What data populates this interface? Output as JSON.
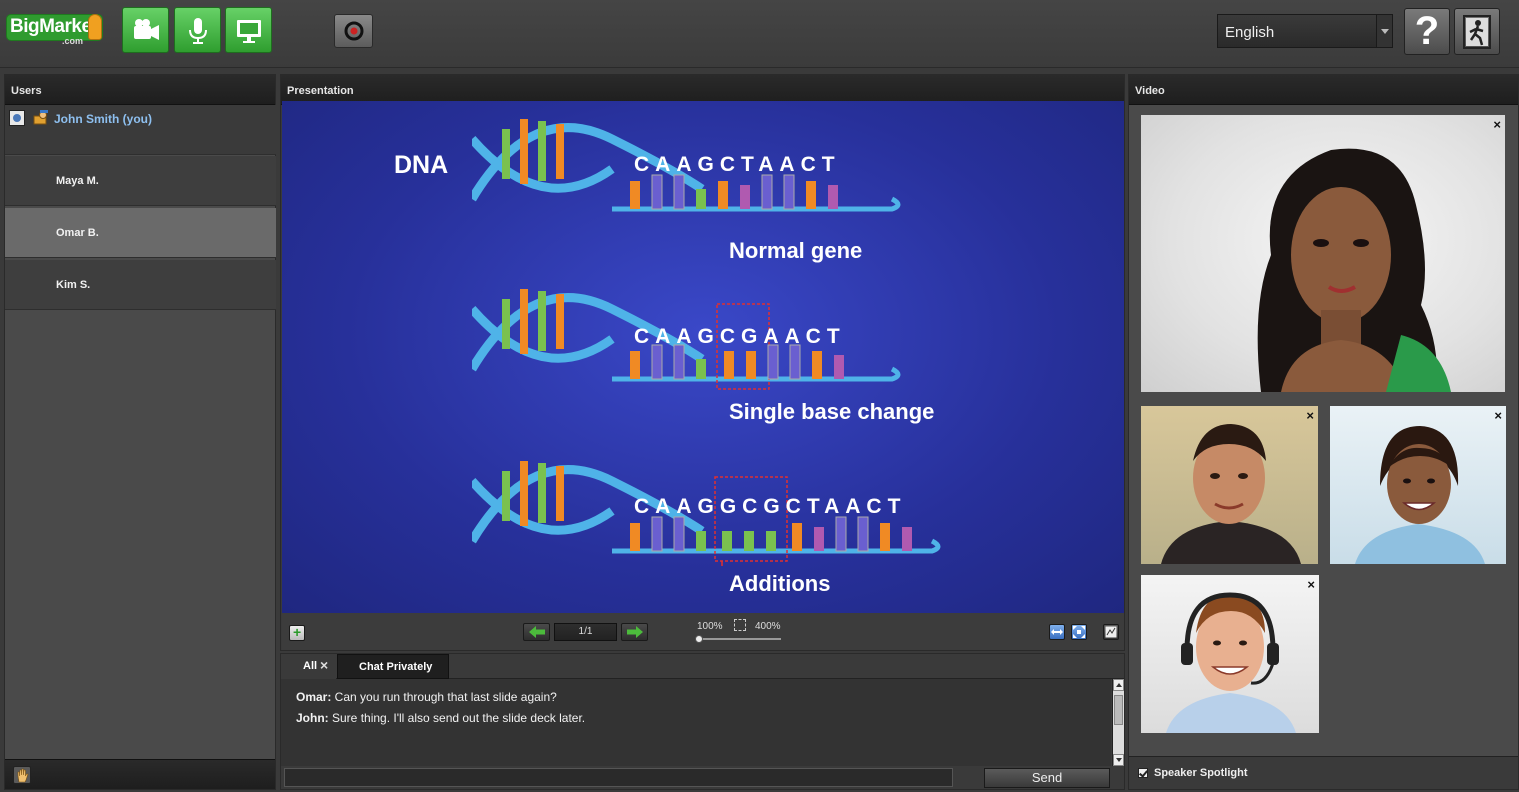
{
  "topbar": {
    "logo_text": "BigMarker",
    "logo_sub": ".com",
    "language": "English",
    "help_label": "?"
  },
  "users": {
    "title": "Users",
    "items": [
      {
        "name": "John Smith (you)"
      },
      {
        "name": "Maya M."
      },
      {
        "name": "Omar B."
      },
      {
        "name": "Kim S."
      }
    ]
  },
  "presentation": {
    "title": "Presentation",
    "slide": {
      "title": "DNA",
      "rows": [
        {
          "sequence": "CAAGCTAACT",
          "label": "Normal gene"
        },
        {
          "sequence": "CAAGCGAACT",
          "label": "Single base change"
        },
        {
          "sequence": "CAAGGCGCTAACT",
          "label": "Additions"
        }
      ]
    },
    "toolbar": {
      "page_indicator": "1/1",
      "zoom_min": "100%",
      "zoom_max": "400%",
      "zoom_level": 0
    }
  },
  "chat": {
    "tabs": {
      "all": "All",
      "private": "Chat Privately"
    },
    "messages": [
      {
        "author": "Omar:",
        "text": " Can you run through that last slide again?"
      },
      {
        "author": "John:",
        "text": " Sure thing. I'll also send out the slide deck later."
      }
    ],
    "input_value": "",
    "send_label": "Send"
  },
  "video": {
    "title": "Video",
    "close_glyph": "×",
    "spotlight_label": "Speaker Spotlight",
    "spotlight_checked": true
  }
}
